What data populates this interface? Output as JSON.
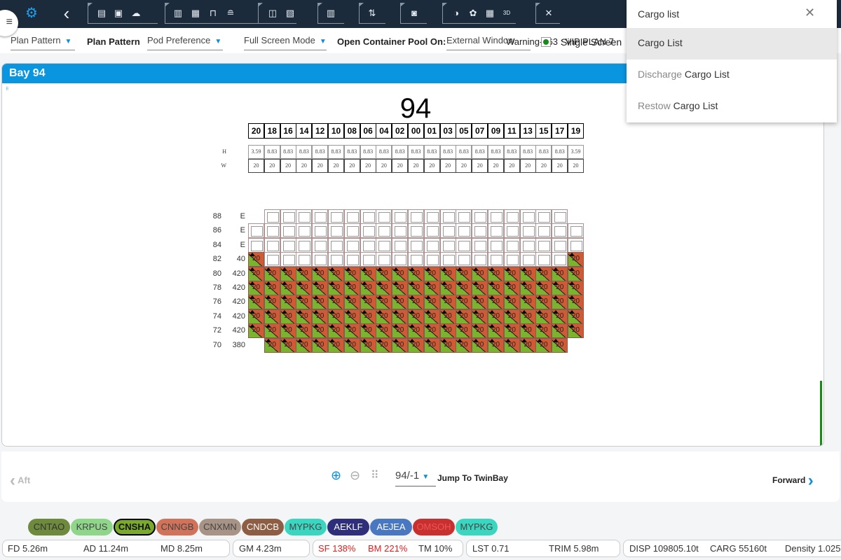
{
  "toolbar": {
    "icons": [
      "gear-icon",
      "back-icon",
      "open-icon",
      "save-icon",
      "upload-icon",
      "layout-icon",
      "rows-icon",
      "unlock-icon",
      "stack-icon",
      "bin-icon",
      "image-icon",
      "chart-icon",
      "swap-icon",
      "bag-icon",
      "contrast-icon",
      "palette-icon",
      "grid-icon",
      "3d-icon",
      "collapse-icon"
    ],
    "glyphs": [
      "⚙",
      "‹",
      "▤",
      "▣",
      "☁",
      "▥",
      "▦",
      "⊓",
      "≘",
      "◫",
      "▧",
      "▥",
      "⇅",
      "◙",
      "◑",
      "✿",
      "▦",
      "3D",
      "✕"
    ]
  },
  "menu_icon": "≡",
  "filters": {
    "plan_pattern_select": "Plan Pattern",
    "plan_pattern_label": "Plan Pattern",
    "pod_preference": "Pod Preference",
    "full_screen": "Full Screen Mode",
    "pool_label": "Open Container Pool On:",
    "pool_value": "External Window",
    "warning": "Warning-763 : VIP PLAN 7",
    "single_screen": "Single Screen"
  },
  "search": {
    "value": "Cargo list",
    "close": "✕",
    "options": [
      {
        "prefix": "",
        "match": "Cargo List"
      },
      {
        "prefix": "Discharge ",
        "match": "Cargo List"
      },
      {
        "prefix": "Restow ",
        "match": "Cargo List"
      }
    ]
  },
  "bay": {
    "title": "Bay 94",
    "number": "94",
    "columns": [
      "20",
      "18",
      "16",
      "14",
      "12",
      "10",
      "08",
      "06",
      "04",
      "02",
      "00",
      "01",
      "03",
      "05",
      "07",
      "09",
      "11",
      "13",
      "15",
      "17",
      "19"
    ],
    "h_label": "H",
    "w_label": "W",
    "heights": [
      "3.59",
      "8.83",
      "8.83",
      "8.83",
      "8.83",
      "8.83",
      "8.83",
      "8.83",
      "8.83",
      "8.83",
      "8.83",
      "8.83",
      "8.83",
      "8.83",
      "8.83",
      "8.83",
      "8.83",
      "8.83",
      "8.83",
      "8.83",
      "3.59"
    ],
    "widths": [
      "20",
      "20",
      "20",
      "20",
      "20",
      "20",
      "20",
      "20",
      "20",
      "20",
      "20",
      "20",
      "20",
      "20",
      "20",
      "20",
      "20",
      "20",
      "20",
      "20",
      "20"
    ],
    "cell_label": "20",
    "rows": [
      {
        "tier": "88",
        "count": "E",
        "slots": "-eeeeeeeeeeeeeeeeeee-"
      },
      {
        "tier": "86",
        "count": "E",
        "slots": "eeeeeeeeeeeeeeeeeeeee"
      },
      {
        "tier": "84",
        "count": "E",
        "slots": "eeeeeeeeeeeeeeeeeeeee"
      },
      {
        "tier": "82",
        "count": "40",
        "slots": "feeeeeeeeeeeeeeeeeeef"
      },
      {
        "tier": "80",
        "count": "420",
        "slots": "fffffffffffffffffffff"
      },
      {
        "tier": "78",
        "count": "420",
        "slots": "fffffffffffffffffffff"
      },
      {
        "tier": "76",
        "count": "420",
        "slots": "fffffffffffffffffffff"
      },
      {
        "tier": "74",
        "count": "420",
        "slots": "fffffffffffffffffffff"
      },
      {
        "tier": "72",
        "count": "420",
        "slots": "fffffffffffffffffffff"
      },
      {
        "tier": "70",
        "count": "380",
        "slots": "-fffffffffffffffffff-"
      }
    ]
  },
  "nav": {
    "aft": "Aft",
    "forward": "Forward",
    "bay_select": "94/-1",
    "jump": "Jump To TwinBay"
  },
  "ports": [
    {
      "code": "CNTAO",
      "bg": "#6e8a3c",
      "fg": "#333"
    },
    {
      "code": "KRPUS",
      "bg": "#8fd68a",
      "fg": "#444"
    },
    {
      "code": "CNSHA",
      "bg": "#7aaa2a",
      "fg": "#111",
      "active": true
    },
    {
      "code": "CNNGB",
      "bg": "#d0735a",
      "fg": "#444"
    },
    {
      "code": "CNXMN",
      "bg": "#a89486",
      "fg": "#444"
    },
    {
      "code": "CNDCB",
      "bg": "#8e5e44",
      "fg": "#fff"
    },
    {
      "code": "MYPKG",
      "bg": "#3bd6c0",
      "fg": "#444"
    },
    {
      "code": "AEKLF",
      "bg": "#2e2e7a",
      "fg": "#fff"
    },
    {
      "code": "AEJEA",
      "bg": "#4a78c0",
      "fg": "#fff"
    },
    {
      "code": "OMSOH",
      "bg": "#c83030",
      "fg": "#e55"
    },
    {
      "code": "MYPKG",
      "bg": "#3bd6c0",
      "fg": "#444"
    }
  ],
  "stats": {
    "fd": "FD 5.26m",
    "ad": "AD 11.24m",
    "md": "MD 8.25m",
    "gm": "GM 4.23m",
    "sf": "SF 138%",
    "bm": "BM 221%",
    "tm": "TM 10%",
    "lst": "LST 0.71",
    "trim": "TRIM 5.98m",
    "disp": "DISP 109805.10t",
    "carg": "CARG 55160t",
    "density": "Density 1.025"
  },
  "colors": {
    "toolbar": "#1c2b3c",
    "accent": "#0a95e0",
    "filled": "#d05a35",
    "alert": "#e02020"
  }
}
